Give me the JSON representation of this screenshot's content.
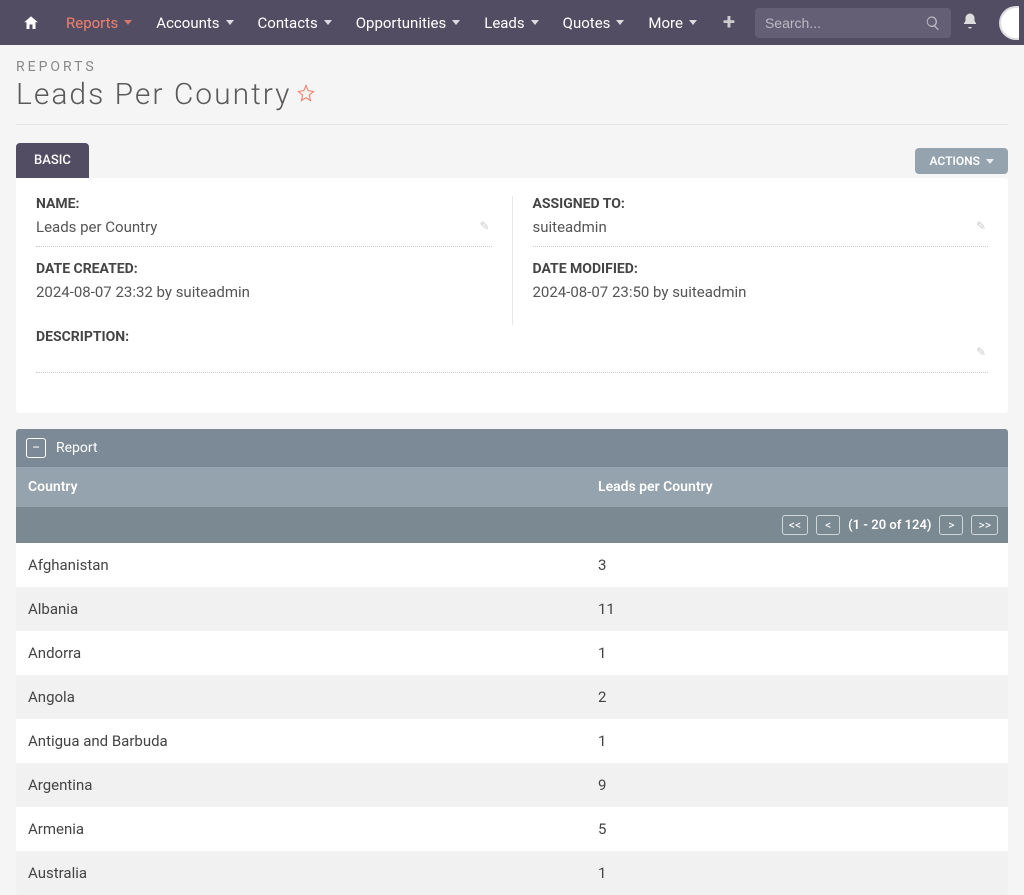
{
  "nav": {
    "items": [
      {
        "label": "Reports",
        "active": true
      },
      {
        "label": "Accounts"
      },
      {
        "label": "Contacts"
      },
      {
        "label": "Opportunities"
      },
      {
        "label": "Leads"
      },
      {
        "label": "Quotes"
      },
      {
        "label": "More"
      }
    ],
    "search_placeholder": "Search..."
  },
  "page": {
    "crumb": "REPORTS",
    "title": "Leads Per Country",
    "tab_basic": "BASIC",
    "actions": "ACTIONS"
  },
  "details": {
    "name_label": "NAME:",
    "name_value": "Leads per Country",
    "assigned_label": "ASSIGNED TO:",
    "assigned_value": "suiteadmin",
    "created_label": "DATE CREATED:",
    "created_value": "2024-08-07 23:32 by suiteadmin",
    "modified_label": "DATE MODIFIED:",
    "modified_value": "2024-08-07 23:50 by suiteadmin",
    "description_label": "DESCRIPTION:",
    "description_value": ""
  },
  "report": {
    "panel_title": "Report",
    "col_country": "Country",
    "col_leads": "Leads per Country",
    "pager": {
      "first": "<<",
      "prev": "<",
      "next": ">",
      "last": ">>",
      "range": "(1 - 20 of 124)"
    },
    "rows": [
      {
        "country": "Afghanistan",
        "leads": "3"
      },
      {
        "country": "Albania",
        "leads": "11"
      },
      {
        "country": "Andorra",
        "leads": "1"
      },
      {
        "country": "Angola",
        "leads": "2"
      },
      {
        "country": "Antigua and Barbuda",
        "leads": "1"
      },
      {
        "country": "Argentina",
        "leads": "9"
      },
      {
        "country": "Armenia",
        "leads": "5"
      },
      {
        "country": "Australia",
        "leads": "1"
      }
    ]
  }
}
